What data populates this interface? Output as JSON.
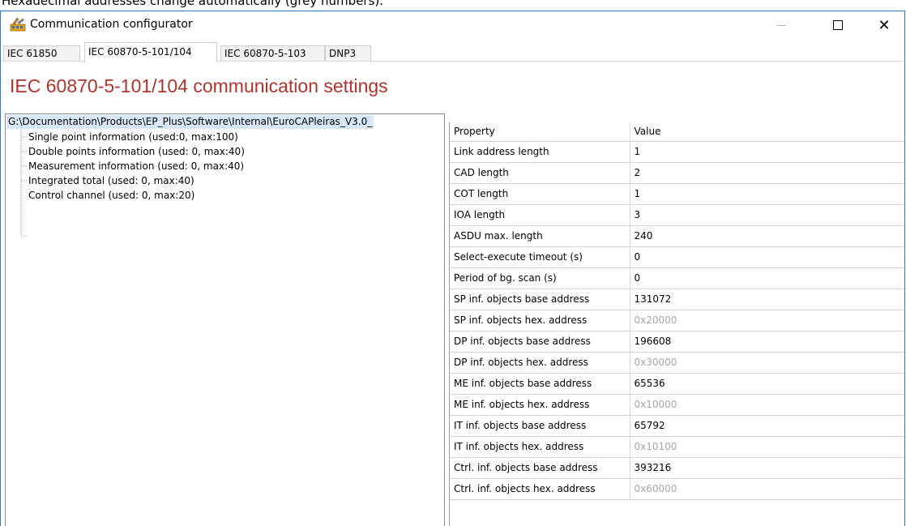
{
  "caption": "Hexadecimal addresses change automatically (grey numbers).",
  "window": {
    "title": "Communication configurator",
    "icon": "configurator-app-icon"
  },
  "tabs": [
    {
      "label": "IEC 61850",
      "active": false
    },
    {
      "label": "IEC 60870-5-101/104",
      "active": true
    },
    {
      "label": "IEC 60870-5-103",
      "active": false
    },
    {
      "label": "DNP3",
      "active": false
    }
  ],
  "heading": "IEC 60870-5-101/104 communication settings",
  "tree": {
    "root": "G:\\Documentation\\Products\\EP_Plus\\Software\\Internal\\EuroCAPleiras_V3.0_",
    "items": [
      "Single point information (used:0, max:100)",
      "Double points information (used: 0, max:40)",
      "Measurement information (used: 0, max:40)",
      "Integrated total (used: 0, max:40)",
      "Control channel (used: 0, max:20)"
    ]
  },
  "grid": {
    "headers": [
      "Property",
      "Value"
    ],
    "rows": [
      {
        "property": "Link address length",
        "value": "1",
        "grey": false
      },
      {
        "property": "CAD length",
        "value": "2",
        "grey": false
      },
      {
        "property": "COT length",
        "value": "1",
        "grey": false
      },
      {
        "property": "IOA length",
        "value": "3",
        "grey": false
      },
      {
        "property": "ASDU max. length",
        "value": "240",
        "grey": false
      },
      {
        "property": "Select-execute timeout (s)",
        "value": "0",
        "grey": false
      },
      {
        "property": "Period of bg. scan (s)",
        "value": "0",
        "grey": false
      },
      {
        "property": "SP inf. objects base address",
        "value": "131072",
        "grey": false
      },
      {
        "property": "SP inf. objects hex. address",
        "value": "0x20000",
        "grey": true
      },
      {
        "property": "DP inf. objects base address",
        "value": "196608",
        "grey": false
      },
      {
        "property": "DP inf. objects hex. address",
        "value": "0x30000",
        "grey": true
      },
      {
        "property": "ME inf. objects base address",
        "value": "65536",
        "grey": false
      },
      {
        "property": "ME inf. objects hex. address",
        "value": "0x10000",
        "grey": true
      },
      {
        "property": "IT inf. objects base address",
        "value": "65792",
        "grey": false
      },
      {
        "property": "IT inf. objects hex. address",
        "value": "0x10100",
        "grey": true
      },
      {
        "property": "Ctrl. inf. objects base address",
        "value": "393216",
        "grey": false
      },
      {
        "property": "Ctrl. inf. objects hex. address",
        "value": "0x60000",
        "grey": true
      }
    ]
  },
  "colors": {
    "heading": "#b0332c",
    "window_border": "#2b7bd6",
    "tree_selection": "#d8e8f8",
    "grey_value": "#a5a5a5"
  }
}
